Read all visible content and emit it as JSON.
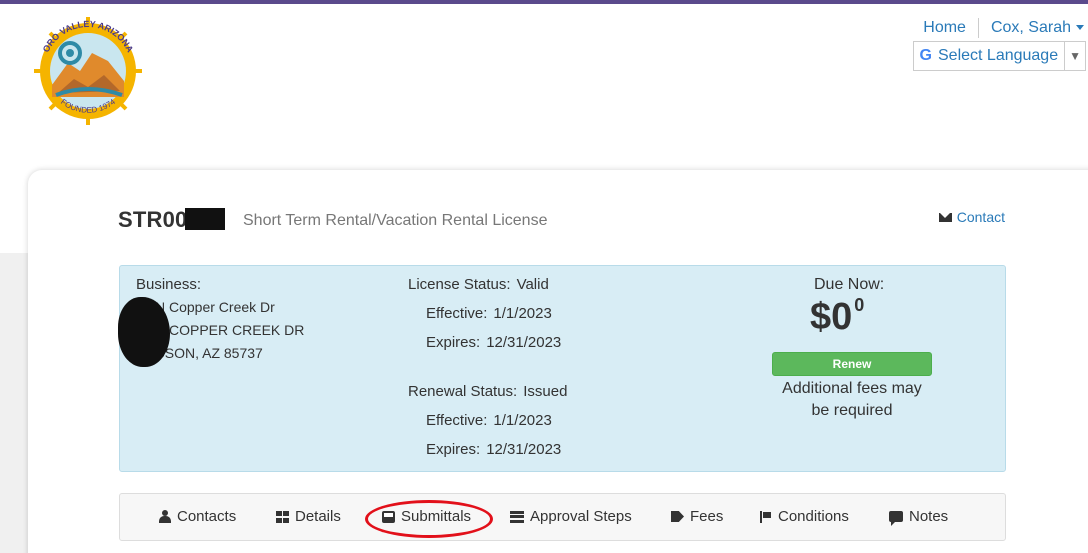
{
  "logo": {
    "top_text": "ORO VALLEY ARIZONA",
    "bottom_text": "FOUNDED 1974"
  },
  "nav": {
    "home": "Home",
    "user": "Cox, Sarah"
  },
  "language": {
    "g_glyph": "G",
    "label": "Select Language",
    "arrow": "▼"
  },
  "license": {
    "number": "STR00",
    "type": "Short Term Rental/Vacation Rental License",
    "contact_label": "Contact"
  },
  "business": {
    "label": "Business:",
    "line1": "N Copper Creek Dr",
    "line2": "N COPPER CREEK DR",
    "line3": "TUCSON,  AZ  85737"
  },
  "license_status": {
    "label": "License Status:",
    "value": "Valid",
    "effective_label": "Effective:",
    "effective": "1/1/2023",
    "expires_label": "Expires:",
    "expires": "12/31/2023"
  },
  "renewal_status": {
    "label": "Renewal Status:",
    "value": "Issued",
    "effective_label": "Effective:",
    "effective": "1/1/2023",
    "expires_label": "Expires:",
    "expires": "12/31/2023"
  },
  "due": {
    "label": "Due Now:",
    "amount": "$0",
    "cents": "0",
    "renew_label": "Renew",
    "note": "Additional fees may be required"
  },
  "tabs": [
    {
      "label": "Contacts",
      "icon": "person-icon"
    },
    {
      "label": "Details",
      "icon": "grid-icon"
    },
    {
      "label": "Submittals",
      "icon": "inbox-icon"
    },
    {
      "label": "Approval Steps",
      "icon": "list-icon"
    },
    {
      "label": "Fees",
      "icon": "tag-icon"
    },
    {
      "label": "Conditions",
      "icon": "flag-icon"
    },
    {
      "label": "Notes",
      "icon": "comment-icon"
    }
  ],
  "colors": {
    "link": "#2a7ab8",
    "info_bg": "#d8edf5",
    "renew_green": "#5cb85c",
    "annotation_red": "#e2101a",
    "topbar": "#5b4a8c"
  }
}
